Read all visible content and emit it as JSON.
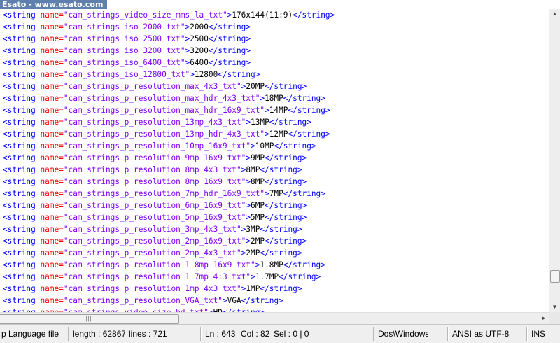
{
  "watermark": "Esato - www.esato.com",
  "editor": {
    "lines": [
      {
        "name": "cam_strings_video_size_mms_la_txt",
        "value": "176x144(11:9)"
      },
      {
        "name": "cam_strings_iso_2000_txt",
        "value": "2000"
      },
      {
        "name": "cam_strings_iso_2500_txt",
        "value": "2500"
      },
      {
        "name": "cam_strings_iso_3200_txt",
        "value": "3200"
      },
      {
        "name": "cam_strings_iso_6400_txt",
        "value": "6400"
      },
      {
        "name": "cam_strings_iso_12800_txt",
        "value": "12800"
      },
      {
        "name": "cam_strings_p_resolution_max_4x3_txt",
        "value": "20MP"
      },
      {
        "name": "cam_strings_p_resolution_max_hdr_4x3_txt",
        "value": "18MP"
      },
      {
        "name": "cam_strings_p_resolution_max_hdr_16x9_txt",
        "value": "14MP"
      },
      {
        "name": "cam_strings_p_resolution_13mp_4x3_txt",
        "value": "13MP"
      },
      {
        "name": "cam_strings_p_resolution_13mp_hdr_4x3_txt",
        "value": "12MP"
      },
      {
        "name": "cam_strings_p_resolution_10mp_16x9_txt",
        "value": "10MP"
      },
      {
        "name": "cam_strings_p_resolution_9mp_16x9_txt",
        "value": "9MP"
      },
      {
        "name": "cam_strings_p_resolution_8mp_4x3_txt",
        "value": "8MP"
      },
      {
        "name": "cam_strings_p_resolution_8mp_16x9_txt",
        "value": "8MP"
      },
      {
        "name": "cam_strings_p_resolution_7mp_hdr_16x9_txt",
        "value": "7MP"
      },
      {
        "name": "cam_strings_p_resolution_6mp_16x9_txt",
        "value": "6MP"
      },
      {
        "name": "cam_strings_p_resolution_5mp_16x9_txt",
        "value": "5MP"
      },
      {
        "name": "cam_strings_p_resolution_3mp_4x3_txt",
        "value": "3MP"
      },
      {
        "name": "cam_strings_p_resolution_2mp_16x9_txt",
        "value": "2MP"
      },
      {
        "name": "cam_strings_p_resolution_2mp_4x3_txt",
        "value": "2MP"
      },
      {
        "name": "cam_strings_p_resolution_1_8mp_16x9_txt",
        "value": "1.8MP"
      },
      {
        "name": "cam_strings_p_resolution_1_7mp_4:3_txt",
        "value": "1.7MP"
      },
      {
        "name": "cam_strings_p_resolution_1mp_4x3_txt",
        "value": "1MP"
      },
      {
        "name": "cam_strings_p_resolution_VGA_txt",
        "value": "VGA"
      },
      {
        "name": "cam_strings_video_size_hd_txt",
        "value": "HD"
      }
    ]
  },
  "statusbar": {
    "file_type": "p Language file",
    "length": "length : 62867",
    "lines": "lines : 721",
    "ln": "Ln : 643",
    "col": "Col : 82",
    "sel": "Sel : 0 | 0",
    "eol": "Dos\\Windows",
    "encoding": "ANSI as UTF-8",
    "mode": "INS"
  },
  "colors": {
    "tag": "#0000ff",
    "attribute": "#ff0000",
    "attribute_value": "#8000ff",
    "text": "#000000"
  },
  "icons": {
    "scroll_up": "triangle-up",
    "scroll_down": "triangle-down",
    "scroll_left": "triangle-left",
    "scroll_right": "triangle-right",
    "thumb_grip": "grip-lines"
  }
}
